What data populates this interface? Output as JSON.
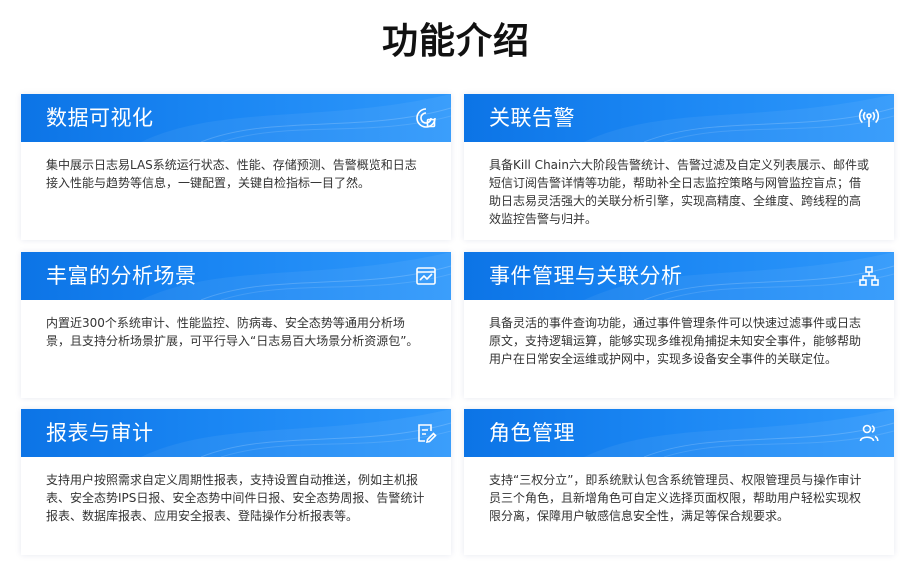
{
  "page": {
    "title": "功能介绍"
  },
  "colors": {
    "header_start": "#0c74e6",
    "header_end": "#2f98fb",
    "title_text": "#111111",
    "body_text": "#333333"
  },
  "cards": [
    {
      "title": "数据可视化",
      "icon": "chart-gauge-icon",
      "body": "集中展示日志易LAS系统运行状态、性能、存储预测、告警概览和日志接入性能与趋势等信息，一键配置，关键自检指标一目了然。"
    },
    {
      "title": "关联告警",
      "icon": "broadcast-icon",
      "body": "具备Kill Chain六大阶段告警统计、告警过滤及自定义列表展示、邮件或短信订阅告警详情等功能，帮助补全日志监控策略与网管监控盲点；借助日志易灵活强大的关联分析引擎，实现高精度、全维度、跨线程的高效监控告警与归并。"
    },
    {
      "title": "丰富的分析场景",
      "icon": "trend-window-icon",
      "body": "内置近300个系统审计、性能监控、防病毒、安全态势等通用分析场景，且支持分析场景扩展，可平行导入“日志易百大场景分析资源包”。"
    },
    {
      "title": "事件管理与关联分析",
      "icon": "hierarchy-icon",
      "body": "具备灵活的事件查询功能，通过事件管理条件可以快速过滤事件或日志原文，支持逻辑运算，能够实现多维视角捕捉未知安全事件，能够帮助用户在日常安全运维或护网中，实现多设备安全事件的关联定位。"
    },
    {
      "title": "报表与审计",
      "icon": "document-edit-icon",
      "body": "支持用户按照需求自定义周期性报表，支持设置自动推送，例如主机报表、安全态势IPS日报、安全态势中间件日报、安全态势周报、告警统计报表、数据库报表、应用安全报表、登陆操作分析报表等。"
    },
    {
      "title": "角色管理",
      "icon": "users-icon",
      "body": "支持“三权分立”，即系统默认包含系统管理员、权限管理员与操作审计员三个角色，且新增角色可自定义选择页面权限，帮助用户轻松实现权限分离，保障用户敏感信息安全性，满足等保合规要求。"
    }
  ]
}
